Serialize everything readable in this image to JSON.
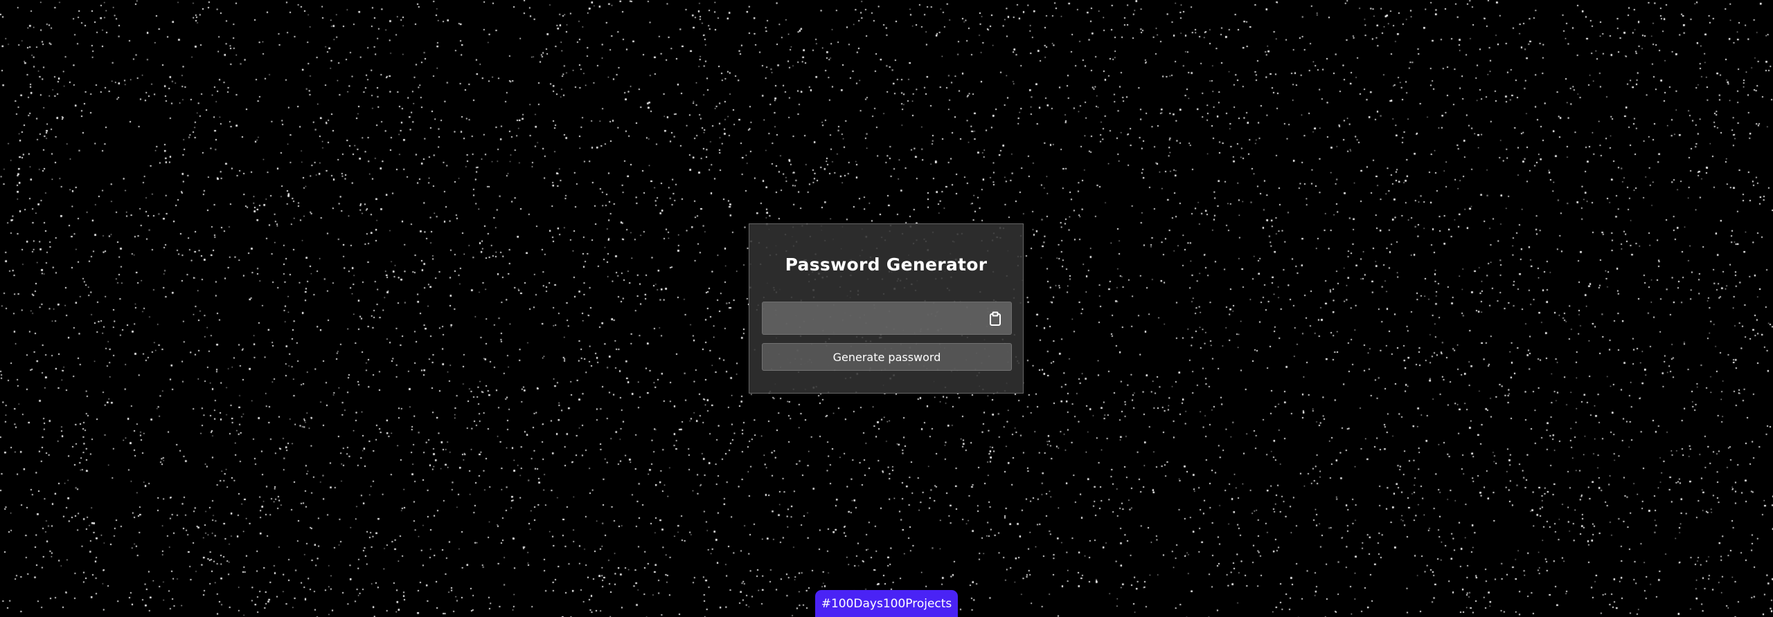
{
  "app": {
    "title": "Password Generator"
  },
  "password_field": {
    "value": "",
    "placeholder": "",
    "copy_icon": "clipboard-icon"
  },
  "actions": {
    "generate_label": "Generate password"
  },
  "footer": {
    "badge_label": "#100Days100Projects"
  },
  "colors": {
    "background": "#000000",
    "card": "#323232",
    "badge": "#4a23f5",
    "text": "#ffffff"
  }
}
